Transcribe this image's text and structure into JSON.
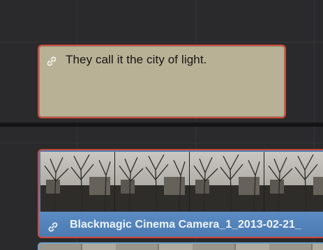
{
  "timeline": {
    "subtitle_track": {
      "clip": {
        "text": "They call it the city of light.",
        "icon": "link-icon",
        "selected": true
      }
    },
    "video_track": {
      "clip": {
        "name": "Blackmagic Cinema Camera_1_2013-02-21_",
        "icon": "link-icon",
        "selected": true
      }
    }
  },
  "colors": {
    "selection_outline": "#d14a3b",
    "subtitle_clip": "#b9b195",
    "video_clip_bar": "#5c8cc4",
    "timeline_bg": "#2a2a2c"
  }
}
